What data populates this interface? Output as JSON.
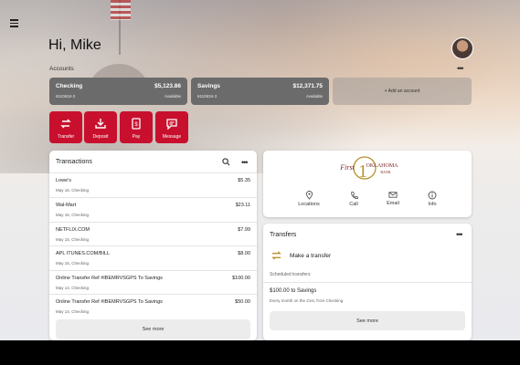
{
  "header": {
    "greeting": "Hi, Mike"
  },
  "accounts": {
    "title": "Accounts",
    "items": [
      {
        "name": "Checking",
        "number": "6110634-3",
        "balance": "$5,123.86",
        "available_label": "Available"
      },
      {
        "name": "Savings",
        "number": "6110634-3",
        "balance": "$12,371.75",
        "available_label": "Available"
      }
    ],
    "add_label": "+ Add an account"
  },
  "quick_actions": [
    {
      "label": "Transfer",
      "icon": "transfer-icon"
    },
    {
      "label": "Deposit",
      "icon": "deposit-icon"
    },
    {
      "label": "Pay",
      "icon": "pay-icon"
    },
    {
      "label": "Message",
      "icon": "message-icon"
    }
  ],
  "transactions": {
    "title": "Transactions",
    "rows": [
      {
        "desc": "Lowe's",
        "sub": "May 16, Checking",
        "amount": "$5.35"
      },
      {
        "desc": "Wal-Mart",
        "sub": "May 16, Checking",
        "amount": "$23.11"
      },
      {
        "desc": "NETFLIX.COM",
        "sub": "May 15, Checking",
        "amount": "$7.99"
      },
      {
        "desc": "APL ITUNES.COM/BILL",
        "sub": "May 15, Checking",
        "amount": "$8.00"
      },
      {
        "desc": "Online Transfer Ref #IBEMRVSGPS To Savings",
        "sub": "May 14, Checking",
        "amount": "$100.00"
      },
      {
        "desc": "Online Transfer Ref #IBEMRVSGPS To Savings",
        "sub": "May 14, Checking",
        "amount": "$50.00"
      }
    ],
    "see_more": "See more"
  },
  "bank": {
    "logo_text_1": "First",
    "logo_text_2": "OKLAHOMA",
    "logo_text_3": "BANK",
    "contacts": [
      {
        "label": "Locations",
        "icon": "location-pin-icon"
      },
      {
        "label": "Call",
        "icon": "phone-icon"
      },
      {
        "label": "Email",
        "icon": "email-icon"
      },
      {
        "label": "Info",
        "icon": "info-icon"
      }
    ]
  },
  "transfers": {
    "title": "Transfers",
    "make_transfer": "Make a transfer",
    "scheduled_label": "Scheduled transfers",
    "scheduled": {
      "title": "$100.00 to Savings",
      "sub": "Every month on the 21st, from Checking"
    },
    "see_more": "See more"
  },
  "colors": {
    "accent": "#c8102e",
    "account_tile": "#6b6b6b",
    "brand_gold": "#b8922f"
  }
}
